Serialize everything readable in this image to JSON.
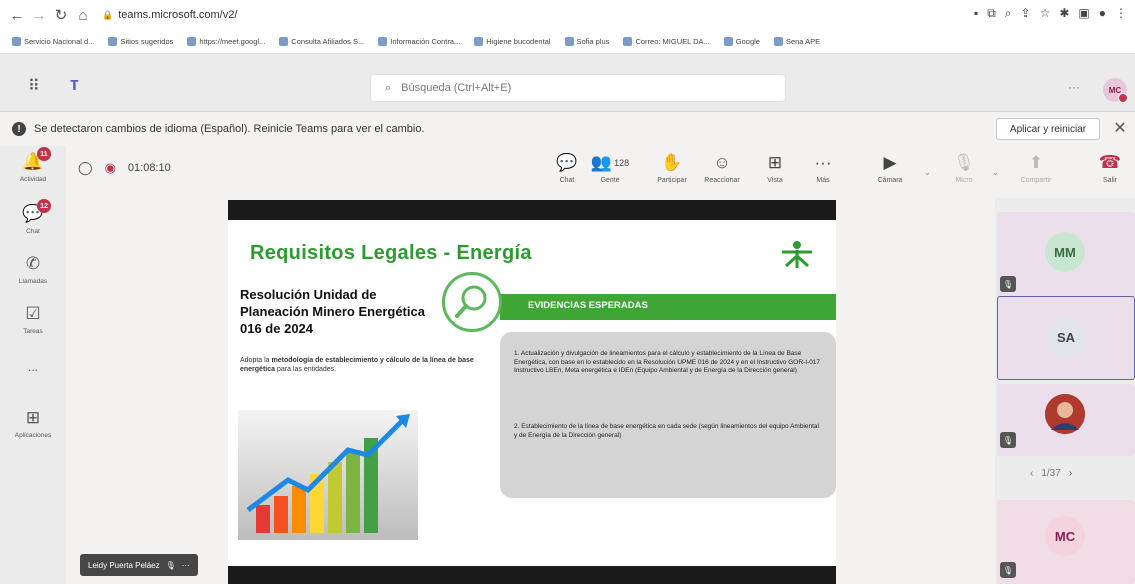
{
  "browser": {
    "url": "teams.microsoft.com/v2/",
    "bookmarks": [
      "Servicio Nacional d...",
      "Sitios sugeridos",
      "https://meet.googl...",
      "Consulta Afiliados S...",
      "Información Contra...",
      "Higiene bucodental",
      "Sofia plus",
      "Correo: MIGUEL DA...",
      "Google",
      "Sena APE"
    ]
  },
  "teams": {
    "search_placeholder": "Búsqueda (Ctrl+Alt+E)",
    "avatar_initials": "MC",
    "notification": "Se detectaron cambios de idioma (Español). Reinicie Teams para ver el cambio.",
    "apply_label": "Aplicar y reiniciar",
    "rail": [
      {
        "label": "Actividad",
        "badge": "11"
      },
      {
        "label": "Chat",
        "badge": "12"
      },
      {
        "label": "Llamadas"
      },
      {
        "label": "Tareas"
      },
      {
        "label": "..."
      },
      {
        "label": "Aplicaciones"
      }
    ],
    "timer": "01:08:10",
    "controls": {
      "chat": "Chat",
      "people": "Gente",
      "people_count": "128",
      "raise": "Participar",
      "react": "Reaccionar",
      "view": "Vista",
      "more": "Más",
      "camera": "Cámara",
      "mic": "Micro",
      "share": "Compartir",
      "leave": "Salir"
    },
    "presenter_name": "Leidy Puerta Peláez",
    "participants": [
      {
        "initials": "MM",
        "color": "#c8e6d0",
        "text_color": "#3a6b48"
      },
      {
        "initials": "SA",
        "color": "#e1e4ea",
        "text_color": "#444"
      },
      {
        "initials": "",
        "color": "#c0392b",
        "text_color": "#fff"
      },
      {
        "initials": "MC",
        "color": "#f3d4de",
        "text_color": "#8a2050"
      }
    ],
    "pager": "1/37"
  },
  "slide": {
    "title": "Requisitos Legales - Energía",
    "resolution": "Resolución Unidad de Planeación Minero Energética 016 de 2024",
    "desc_pre": "Adopta la ",
    "desc_bold1": "metodología de establecimiento y cálculo de la línea de base energética",
    "desc_post": " para las entidades.",
    "evidence_label": "EVIDENCIAS ESPERADAS",
    "evidence_1": "1. Actualización y divulgación de lineamientos para el cálculo y establecimiento de la Línea de Base Energética, con base en lo establecido en la Resolución UPME 016 de 2024 y en el Instructivo GOR-I-017 Instructivo LBEn, Meta energética e IDEn (Equipo Ambiental y de Energía de la Dirección general)",
    "evidence_2": "2. Establecimiento de la línea de base energética en cada sede (según lineamientos del equipo Ambiental y de Energía de la Dirección general)"
  }
}
